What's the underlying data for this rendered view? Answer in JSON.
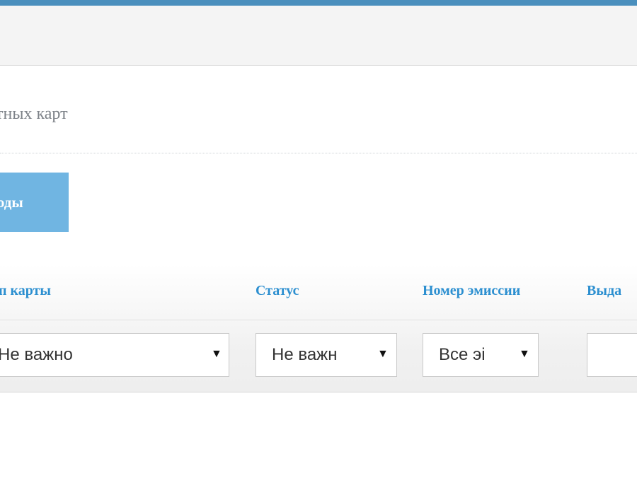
{
  "header": {
    "page_title": "тных карт"
  },
  "actions": {
    "codes_button_label": "коды"
  },
  "filters": {
    "card_type": {
      "label": "п карты",
      "value": "Не важно"
    },
    "status": {
      "label": "Статус",
      "value": "Не важн"
    },
    "emission_number": {
      "label": "Номер эмиссии",
      "value": "Все эі"
    },
    "issued": {
      "label": "Выда",
      "value": ""
    }
  },
  "icons": {
    "dropdown": "chevron-down-icon"
  },
  "colors": {
    "top_bar": "#4a8fbd",
    "button_bg": "#70b5e2",
    "label_text": "#2c8fd0"
  }
}
